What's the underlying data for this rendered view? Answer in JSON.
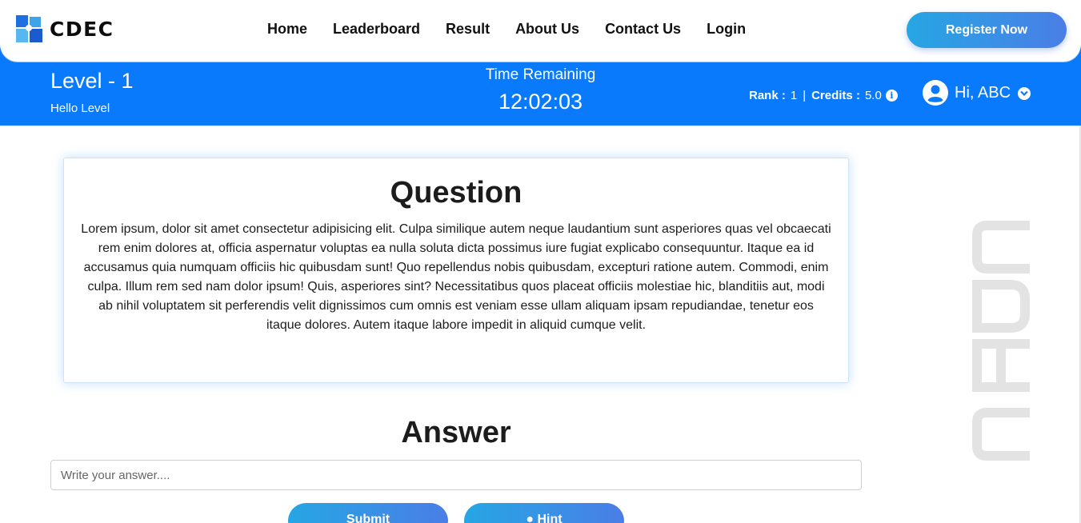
{
  "navbar": {
    "brand": "CDEC",
    "links": [
      "Home",
      "Leaderboard",
      "Result",
      "About Us",
      "Contact Us",
      "Login"
    ],
    "register": "Register Now"
  },
  "level": {
    "title": "Level - 1",
    "subtitle": "Hello Level",
    "time_label": "Time Remaining",
    "time_value": "12:02:03",
    "rank_label": "Rank :",
    "rank_value": "1",
    "separator": "|",
    "credits_label": "Credits :",
    "credits_value": "5.0",
    "user_greeting": "Hi, ABC"
  },
  "question": {
    "title": "Question",
    "body": "Lorem ipsum, dolor sit amet consectetur adipisicing elit. Culpa similique autem neque laudantium sunt asperiores quas vel obcaecati rem enim dolores at, officia aspernatur voluptas ea nulla soluta dicta possimus iure fugiat explicabo consequuntur. Itaque ea id accusamus quia numquam officiis hic quibusdam sunt! Quo repellendus nobis quibusdam, excepturi ratione autem. Commodi, enim culpa. Illum rem sed nam dolor ipsum! Quis, asperiores sint? Necessitatibus quos placeat officiis molestiae hic, blanditiis aut, modi ab nihil voluptatem sit perferendis velit dignissimos cum omnis est veniam esse ullam aliquam ipsam repudiandae, tenetur eos itaque dolores. Autem itaque labore impedit in aliquid cumque velit."
  },
  "answer": {
    "title": "Answer",
    "placeholder": "Write your answer....",
    "submit": "Submit",
    "hint": "Hint"
  },
  "watermark": "CDEC",
  "colors": {
    "band": "#0a7afc",
    "button_gradient_start": "#26a6e4",
    "button_gradient_end": "#4a7ee6",
    "watermark": "#e3e3e3"
  }
}
